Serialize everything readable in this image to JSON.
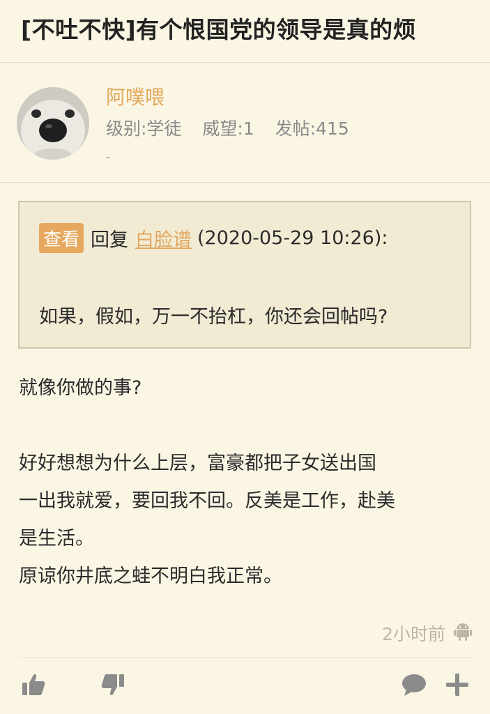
{
  "thread": {
    "title": "[不吐不快]有个恨国党的领导是真的烦"
  },
  "author": {
    "name": "阿噗喂",
    "level_label": "级别:学徒",
    "prestige_label": "威望:1",
    "posts_label": "发帖:415",
    "signature": "-"
  },
  "quote": {
    "view_label": "查看",
    "reply_label": "回复",
    "reply_user": "白脸谱",
    "reply_time": "(2020-05-29 10:26):",
    "text": "如果，假如，万一不抬杠，你还会回帖吗?"
  },
  "post": {
    "line1": "就像你做的事?",
    "line2": "好好想想为什么上层，富豪都把子女送出国",
    "line3": "一出我就爱，要回我不回。反美是工作，赴美",
    "line4": "是生活。",
    "line5": "原谅你井底之蛙不明白我正常。",
    "time": "2小时前"
  },
  "icons": {
    "device": "android-icon",
    "like": "thumbs-up-icon",
    "dislike": "thumbs-down-icon",
    "comment": "comment-icon",
    "more": "plus-icon"
  },
  "colors": {
    "background": "#fbf6e4",
    "accent": "#e2a85d",
    "quote_bg": "#f1ebd4",
    "icon": "#8b8b8b"
  }
}
